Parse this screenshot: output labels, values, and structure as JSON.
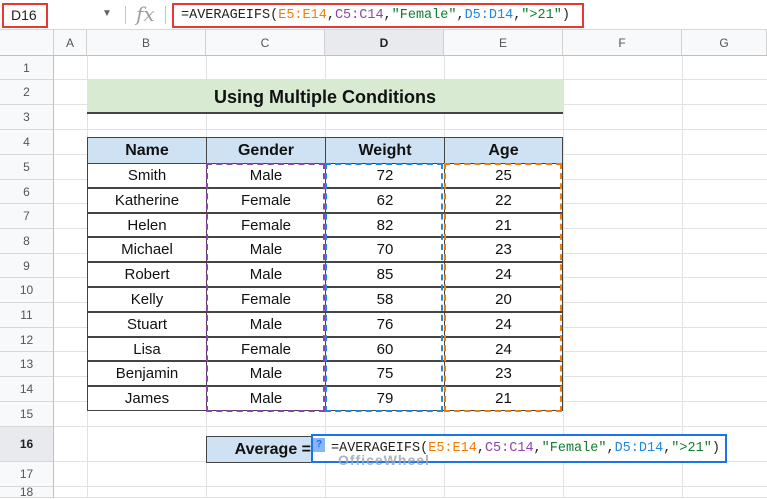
{
  "name_box": "D16",
  "formula": {
    "prefix": "=AVERAGEIFS(",
    "r1": "E5:E14",
    "comma1": ",",
    "r2": "C5:C14",
    "comma2": ",",
    "s1": "\"Female\"",
    "comma3": ",",
    "r3": "D5:D14",
    "comma4": ",",
    "s2": "\">21\"",
    "suffix": ")"
  },
  "fx": "fx",
  "columns": [
    "A",
    "B",
    "C",
    "D",
    "E",
    "F",
    "G"
  ],
  "rows": [
    "1",
    "2",
    "3",
    "4",
    "5",
    "6",
    "7",
    "8",
    "9",
    "10",
    "11",
    "12",
    "13",
    "14",
    "15",
    "16",
    "17",
    "18"
  ],
  "title": "Using Multiple Conditions",
  "table": {
    "headers": [
      "Name",
      "Gender",
      "Weight",
      "Age"
    ],
    "rows": [
      [
        "Smith",
        "Male",
        "72",
        "25"
      ],
      [
        "Katherine",
        "Female",
        "62",
        "22"
      ],
      [
        "Helen",
        "Female",
        "82",
        "21"
      ],
      [
        "Michael",
        "Male",
        "70",
        "23"
      ],
      [
        "Robert",
        "Male",
        "85",
        "24"
      ],
      [
        "Kelly",
        "Female",
        "58",
        "20"
      ],
      [
        "Stuart",
        "Male",
        "76",
        "24"
      ],
      [
        "Lisa",
        "Female",
        "60",
        "24"
      ],
      [
        "Benjamin",
        "Male",
        "75",
        "23"
      ],
      [
        "James",
        "Male",
        "79",
        "21"
      ]
    ]
  },
  "average_label": "Average =",
  "watermark": "OfficeWheel",
  "colors": {
    "range_e": "#f57c00",
    "range_c": "#8e44ad",
    "range_d": "#1e88e5",
    "string": "#0f7d2d",
    "selection": "#1a73e8"
  }
}
